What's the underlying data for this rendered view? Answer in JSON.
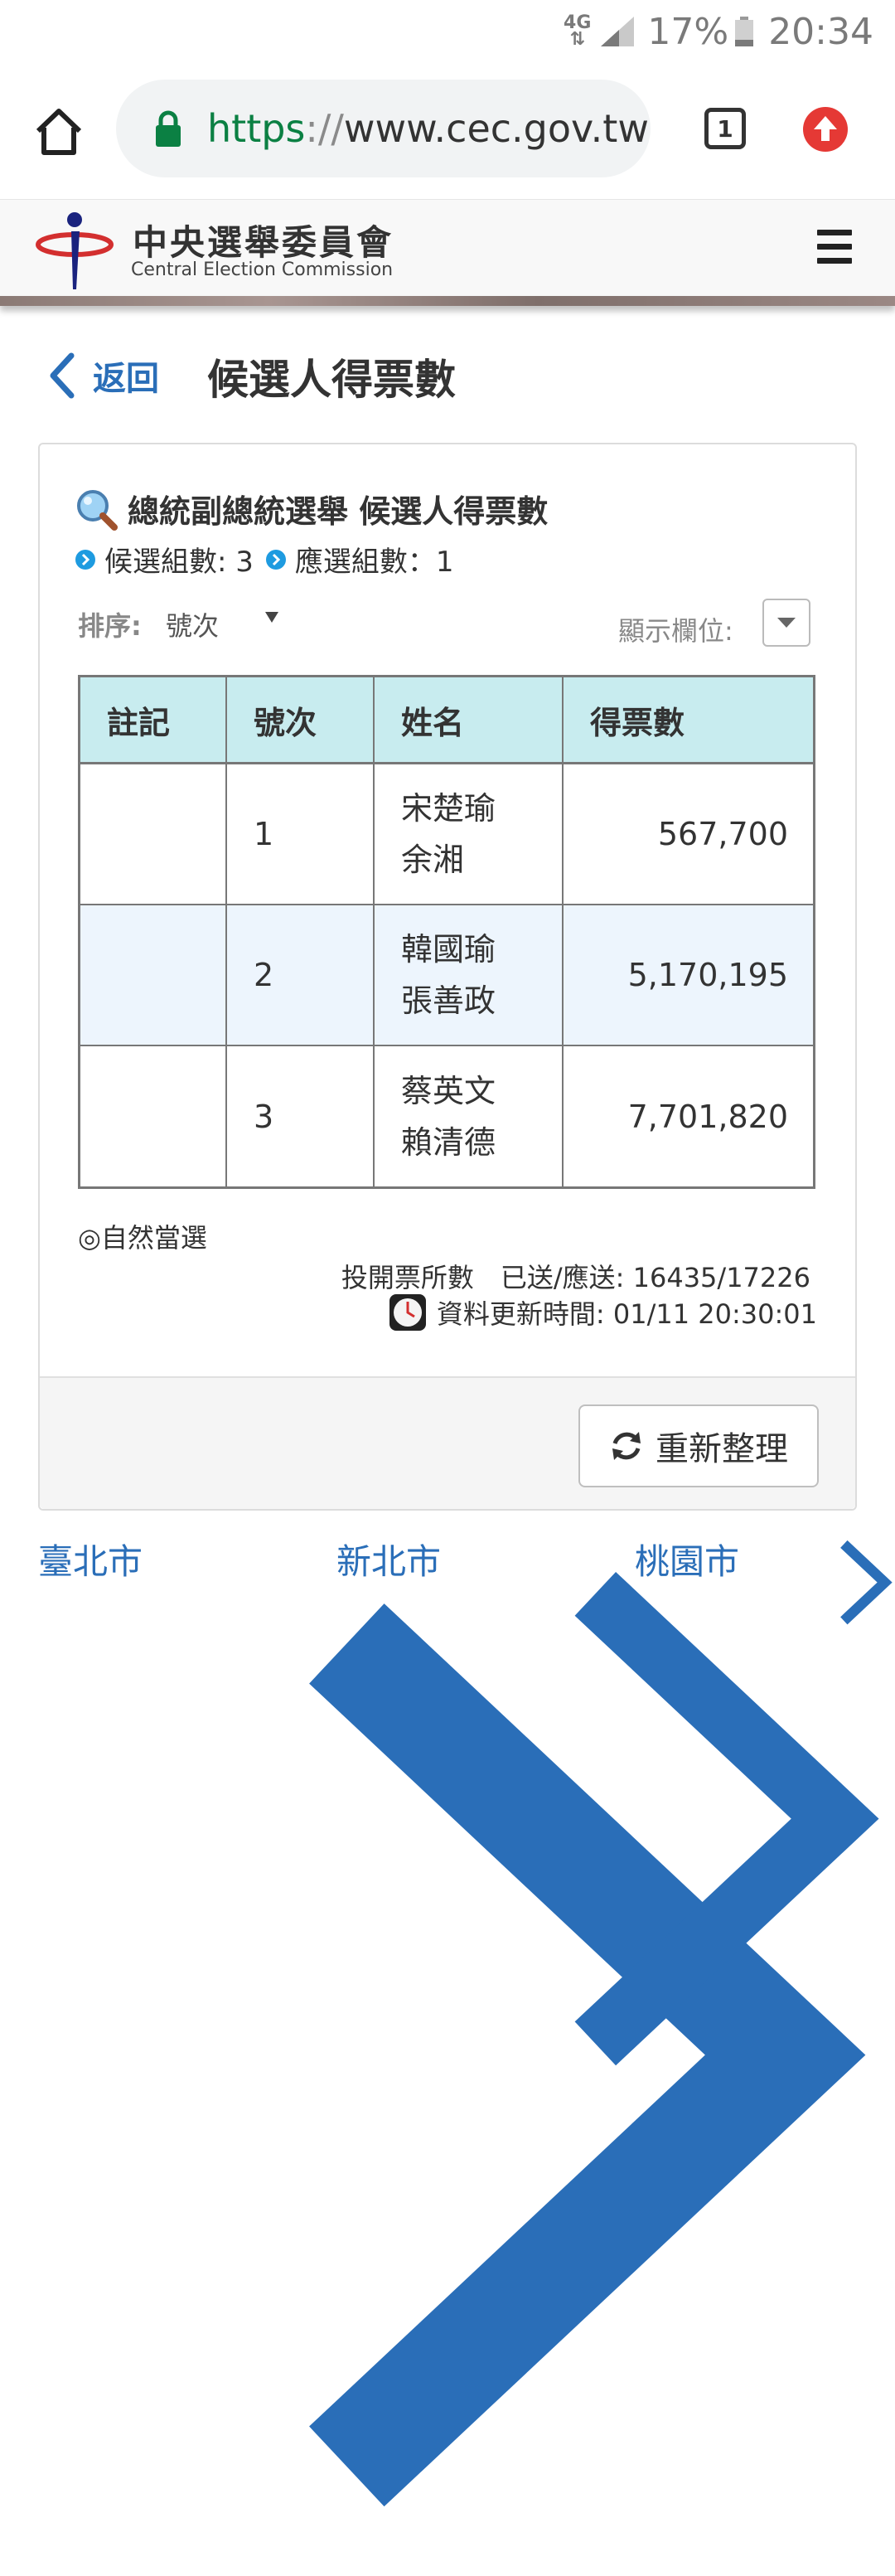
{
  "status_bar": {
    "network": "4G",
    "battery_percent": "17%",
    "time": "20:34"
  },
  "browser": {
    "url_scheme": "https",
    "url_sep": "://",
    "url_host": "www.cec.gov.tw",
    "tab_count": "1",
    "icons": [
      "home-icon",
      "lock-icon",
      "update-icon"
    ]
  },
  "site": {
    "name_cn": "中央選舉委員會",
    "name_en": "Central Election Commission"
  },
  "nav": {
    "back_label": "返回",
    "page_title": "候選人得票數"
  },
  "card": {
    "title": "總統副總統選舉 候選人得票數",
    "candidate_groups_label": "候選組數: 3",
    "elected_groups_label": "應選組數：1",
    "sort_label": "排序:",
    "sort_value": "號次",
    "columns_label": "顯示欄位:"
  },
  "table": {
    "headers": [
      "註記",
      "號次",
      "姓名",
      "得票數"
    ],
    "rows": [
      {
        "note": "",
        "number": "1",
        "name_1": "宋楚瑜",
        "name_2": "余湘",
        "votes": "567,700"
      },
      {
        "note": "",
        "number": "2",
        "name_1": "韓國瑜",
        "name_2": "張善政",
        "votes": "5,170,195"
      },
      {
        "note": "",
        "number": "3",
        "name_1": "蔡英文",
        "name_2": "賴清德",
        "votes": "7,701,820"
      }
    ]
  },
  "footer_info": {
    "legend": "◎自然當選",
    "stations": "投開票所數　已送/應送: 16435/17226",
    "updated": "資料更新時間: 01/11 20:30:01"
  },
  "refresh_label": "重新整理",
  "regions": [
    "臺北市",
    "新北市",
    "桃園市"
  ],
  "colors": {
    "link_blue": "#2a6eb8",
    "table_header_bg": "#c8ecef",
    "alt_row_bg": "#edf5fd",
    "secure_green": "#0b8043",
    "update_red": "#e53935"
  }
}
